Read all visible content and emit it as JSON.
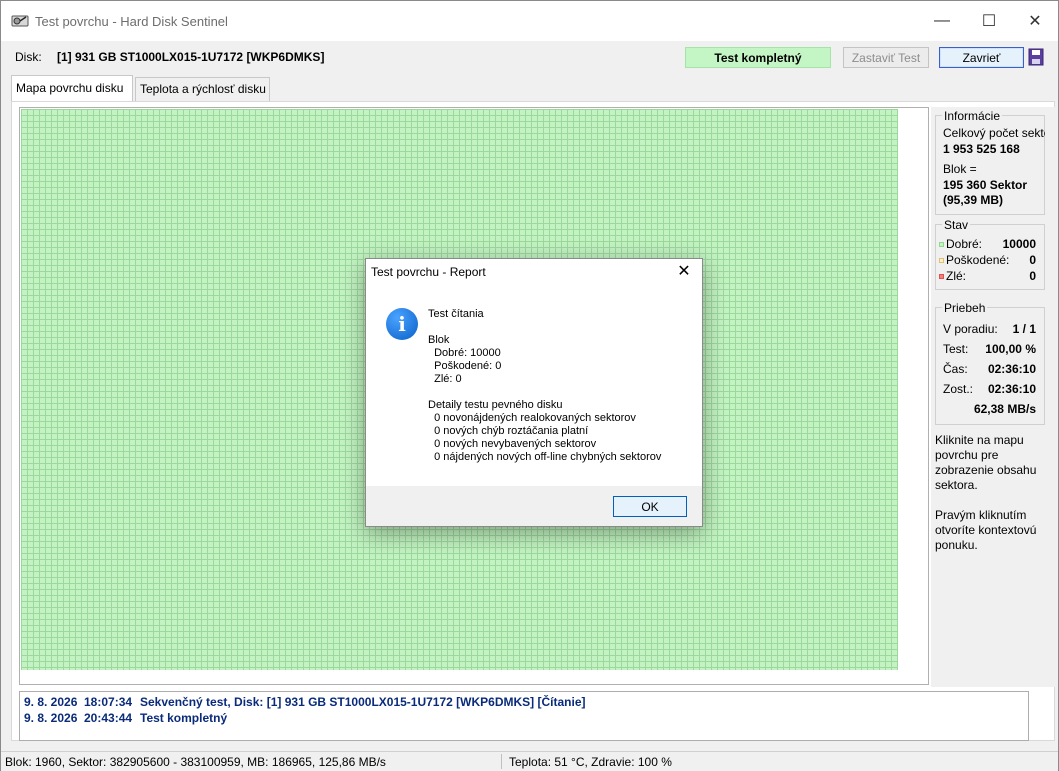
{
  "window": {
    "title": "Test povrchu - Hard Disk Sentinel",
    "minimize": "—",
    "maximize": "☐",
    "close": "✕"
  },
  "toolbar": {
    "disk_label": "Disk:",
    "disk_name": "[1] 931 GB  ST1000LX015-1U7172 [WKP6DMKS]",
    "status": "Test kompletný",
    "stop_label": "Zastaviť Test",
    "close_label": "Zavrieť"
  },
  "tabs": [
    {
      "label": "Mapa povrchu disku",
      "active": true
    },
    {
      "label": "Teplota a rýchlosť disku",
      "active": false
    }
  ],
  "side": {
    "info": {
      "title": "Informácie",
      "total_sectors_label": "Celkový počet sektorov",
      "total_sectors_value": "1 953 525 168",
      "block_label": "Blok =",
      "block_sectors": "195 360 Sektor",
      "block_size": "(95,39 MB)"
    },
    "state": {
      "title": "Stav",
      "good_label": "Dobré:",
      "good_value": "10000",
      "damaged_label": "Poškodené:",
      "damaged_value": "0",
      "bad_label": "Zlé:",
      "bad_value": "0",
      "good_color": "#8fd88f",
      "damaged_color": "#e0c070",
      "bad_color": "#e05050"
    },
    "progress": {
      "title": "Priebeh",
      "order_label": "V poradiu:",
      "order_value": "1 / 1",
      "test_label": "Test:",
      "test_value": "100,00 %",
      "time_label": "Čas:",
      "time_value": "02:36:10",
      "remaining_label": "Zost.:",
      "remaining_value": "02:36:10",
      "speed_value": "62,38 MB/s"
    },
    "hint1": [
      "Kliknite na mapu",
      "povrchu pre",
      "zobrazenie obsahu",
      "sektora."
    ],
    "hint2": [
      "Pravým kliknutím",
      "otvoríte kontextovú",
      "ponuku."
    ]
  },
  "log": [
    {
      "date": "9. 8. 2026",
      "time": "18:07:34",
      "text": "Sekvenčný test, Disk: [1] 931 GB  ST1000LX015-1U7172 [WKP6DMKS] [Čítanie]"
    },
    {
      "date": "9. 8. 2026",
      "time": "20:43:44",
      "text": "Test kompletný"
    }
  ],
  "statusbar": {
    "left": "Blok: 1960, Sektor: 382905600 - 383100959, MB: 186965, 125,86 MB/s",
    "right": "Teplota: 51  °C,  Zdravie: 100 %"
  },
  "dialog": {
    "title": "Test povrchu - Report",
    "close": "✕",
    "icon": "i",
    "lines": [
      "Test čítania",
      "",
      "Blok",
      "  Dobré: 10000",
      "  Poškodené: 0",
      "  Zlé: 0",
      "",
      "Detaily testu pevného disku",
      "  0 novonájdených realokovaných sektorov",
      "  0 nových chýb roztáčania platní",
      "  0 nových nevybavených sektorov",
      "  0 nájdených nových off-line chybných sektorov"
    ],
    "ok_label": "OK"
  }
}
